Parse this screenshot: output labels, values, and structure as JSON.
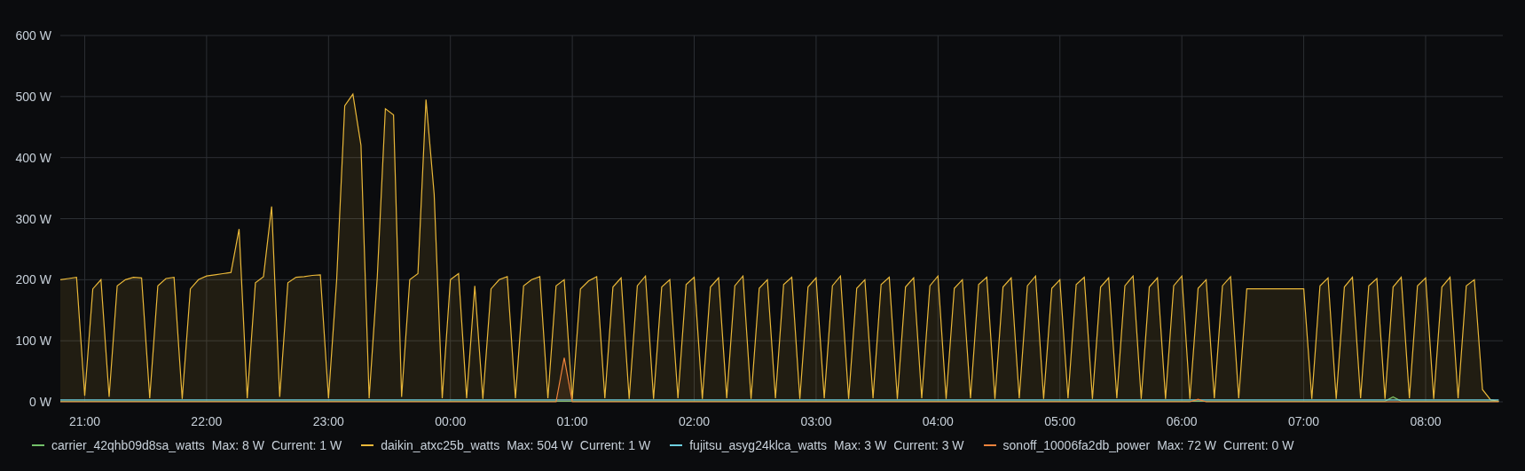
{
  "chart_data": {
    "type": "area",
    "grid": true,
    "ylim": [
      0,
      600
    ],
    "categories": [
      null,
      null,
      null,
      "21:00",
      null,
      null,
      null,
      null,
      null,
      null,
      null,
      null,
      null,
      null,
      null,
      null,
      null,
      null,
      "22:00",
      null,
      null,
      null,
      null,
      null,
      null,
      null,
      null,
      null,
      null,
      null,
      null,
      null,
      null,
      "23:00",
      null,
      null,
      null,
      null,
      null,
      null,
      null,
      null,
      null,
      null,
      null,
      null,
      null,
      null,
      "00:00",
      null,
      null,
      null,
      null,
      null,
      null,
      null,
      null,
      null,
      null,
      null,
      null,
      null,
      null,
      "01:00",
      null,
      null,
      null,
      null,
      null,
      null,
      null,
      null,
      null,
      null,
      null,
      null,
      null,
      null,
      "02:00",
      null,
      null,
      null,
      null,
      null,
      null,
      null,
      null,
      null,
      null,
      null,
      null,
      null,
      null,
      "03:00",
      null,
      null,
      null,
      null,
      null,
      null,
      null,
      null,
      null,
      null,
      null,
      null,
      null,
      null,
      "04:00",
      null,
      null,
      null,
      null,
      null,
      null,
      null,
      null,
      null,
      null,
      null,
      null,
      null,
      null,
      "05:00",
      null,
      null,
      null,
      null,
      null,
      null,
      null,
      null,
      null,
      null,
      null,
      null,
      null,
      null,
      "06:00",
      null,
      null,
      null,
      null,
      null,
      null,
      null,
      null,
      null,
      null,
      null,
      null,
      null,
      null,
      "07:00",
      null,
      null,
      null,
      null,
      null,
      null,
      null,
      null,
      null,
      null,
      null,
      null,
      null,
      null,
      "08:00",
      null,
      null,
      null,
      null,
      null,
      null,
      null,
      null,
      null
    ],
    "yticks": [
      {
        "value": 0,
        "label": "0 W"
      },
      {
        "value": 100,
        "label": "100 W"
      },
      {
        "value": 200,
        "label": "200 W"
      },
      {
        "value": 300,
        "label": "300 W"
      },
      {
        "value": 400,
        "label": "400 W"
      },
      {
        "value": 500,
        "label": "500 W"
      },
      {
        "value": 600,
        "label": "600 W"
      }
    ],
    "series": [
      {
        "name": "carrier_42qhb09d8sa_watts",
        "color": "#73bf69",
        "values": [
          1,
          1,
          1,
          1,
          1,
          1,
          1,
          1,
          1,
          1,
          1,
          1,
          1,
          1,
          1,
          1,
          1,
          1,
          1,
          1,
          1,
          1,
          1,
          1,
          1,
          1,
          1,
          1,
          1,
          1,
          1,
          1,
          1,
          1,
          1,
          1,
          1,
          1,
          1,
          1,
          1,
          1,
          1,
          1,
          1,
          1,
          1,
          1,
          1,
          1,
          1,
          1,
          1,
          1,
          1,
          1,
          1,
          1,
          1,
          1,
          1,
          1,
          1,
          1,
          1,
          1,
          1,
          1,
          1,
          1,
          1,
          1,
          1,
          1,
          1,
          1,
          1,
          1,
          1,
          1,
          1,
          1,
          1,
          1,
          1,
          1,
          1,
          1,
          1,
          1,
          1,
          1,
          1,
          1,
          1,
          1,
          1,
          1,
          1,
          1,
          1,
          1,
          1,
          1,
          1,
          1,
          1,
          1,
          1,
          1,
          1,
          1,
          1,
          1,
          1,
          1,
          1,
          1,
          1,
          1,
          1,
          1,
          1,
          1,
          1,
          1,
          1,
          1,
          1,
          1,
          1,
          1,
          1,
          1,
          1,
          1,
          1,
          1,
          1,
          1,
          1,
          1,
          1,
          1,
          1,
          1,
          1,
          1,
          1,
          1,
          1,
          1,
          1,
          1,
          1,
          1,
          1,
          1,
          1,
          1,
          1,
          1,
          1,
          1,
          8,
          1,
          1,
          1,
          1,
          1,
          1,
          1,
          1,
          1,
          1,
          1,
          1,
          1
        ]
      },
      {
        "name": "daikin_atxc25b_watts",
        "color": "#eab839",
        "values": [
          200,
          202,
          204,
          10,
          185,
          200,
          8,
          190,
          200,
          204,
          203,
          6,
          190,
          202,
          204,
          5,
          185,
          200,
          206,
          208,
          210,
          212,
          283,
          6,
          195,
          205,
          320,
          8,
          195,
          204,
          205,
          207,
          208,
          6,
          200,
          485,
          504,
          420,
          6,
          205,
          480,
          470,
          8,
          200,
          210,
          495,
          340,
          6,
          200,
          210,
          6,
          190,
          5,
          185,
          200,
          205,
          6,
          190,
          200,
          205,
          6,
          190,
          200,
          5,
          185,
          198,
          205,
          6,
          188,
          203,
          5,
          190,
          206,
          5,
          188,
          200,
          6,
          192,
          204,
          5,
          188,
          203,
          6,
          190,
          206,
          5,
          186,
          200,
          6,
          192,
          204,
          5,
          188,
          203,
          6,
          190,
          206,
          5,
          186,
          200,
          6,
          192,
          204,
          5,
          188,
          203,
          6,
          190,
          206,
          5,
          186,
          200,
          6,
          192,
          204,
          5,
          188,
          203,
          6,
          190,
          206,
          5,
          186,
          200,
          6,
          192,
          204,
          5,
          188,
          203,
          6,
          190,
          206,
          5,
          188,
          203,
          5,
          190,
          206,
          5,
          186,
          200,
          6,
          190,
          205,
          6,
          185,
          185,
          185,
          185,
          185,
          185,
          185,
          185,
          5,
          190,
          203,
          5,
          188,
          204,
          6,
          190,
          202,
          5,
          188,
          204,
          6,
          190,
          203,
          5,
          188,
          204,
          6,
          190,
          200,
          20,
          3,
          1
        ]
      },
      {
        "name": "fujitsu_asyg24klca_watts",
        "color": "#6ed0e0",
        "values": [
          3,
          3,
          3,
          3,
          3,
          3,
          3,
          3,
          3,
          3,
          3,
          3,
          3,
          3,
          3,
          3,
          3,
          3,
          3,
          3,
          3,
          3,
          3,
          3,
          3,
          3,
          3,
          3,
          3,
          3,
          3,
          3,
          3,
          3,
          3,
          3,
          3,
          3,
          3,
          3,
          3,
          3,
          3,
          3,
          3,
          3,
          3,
          3,
          3,
          3,
          3,
          3,
          3,
          3,
          3,
          3,
          3,
          3,
          3,
          3,
          3,
          3,
          3,
          3,
          3,
          3,
          3,
          3,
          3,
          3,
          3,
          3,
          3,
          3,
          3,
          3,
          3,
          3,
          3,
          3,
          3,
          3,
          3,
          3,
          3,
          3,
          3,
          3,
          3,
          3,
          3,
          3,
          3,
          3,
          3,
          3,
          3,
          3,
          3,
          3,
          3,
          3,
          3,
          3,
          3,
          3,
          3,
          3,
          3,
          3,
          3,
          3,
          3,
          3,
          3,
          3,
          3,
          3,
          3,
          3,
          3,
          3,
          3,
          3,
          3,
          3,
          3,
          3,
          3,
          3,
          3,
          3,
          3,
          3,
          3,
          3,
          3,
          3,
          3,
          3,
          3,
          3,
          3,
          3,
          3,
          3,
          3,
          3,
          3,
          3,
          3,
          3,
          3,
          3,
          3,
          3,
          3,
          3,
          3,
          3,
          3,
          3,
          3,
          3,
          3,
          3,
          3,
          3,
          3,
          3,
          3,
          3,
          3,
          3,
          3,
          3,
          3,
          3
        ]
      },
      {
        "name": "sonoff_10006fa2db_power",
        "color": "#ef843c",
        "values": [
          0,
          0,
          0,
          0,
          0,
          0,
          0,
          0,
          0,
          0,
          0,
          0,
          0,
          0,
          0,
          0,
          0,
          0,
          0,
          0,
          0,
          0,
          0,
          0,
          0,
          0,
          0,
          0,
          0,
          0,
          0,
          0,
          0,
          0,
          0,
          0,
          0,
          0,
          0,
          0,
          0,
          0,
          0,
          0,
          0,
          0,
          0,
          0,
          0,
          0,
          0,
          0,
          0,
          0,
          0,
          0,
          0,
          0,
          0,
          0,
          0,
          0,
          72,
          0,
          0,
          0,
          0,
          0,
          0,
          0,
          0,
          0,
          0,
          0,
          0,
          0,
          0,
          0,
          0,
          0,
          0,
          0,
          0,
          0,
          0,
          0,
          0,
          0,
          0,
          0,
          0,
          0,
          0,
          0,
          0,
          0,
          0,
          0,
          0,
          0,
          0,
          0,
          0,
          0,
          0,
          0,
          0,
          0,
          0,
          0,
          0,
          0,
          0,
          0,
          0,
          0,
          0,
          0,
          0,
          0,
          0,
          0,
          0,
          0,
          0,
          0,
          0,
          0,
          0,
          0,
          0,
          0,
          0,
          0,
          0,
          0,
          0,
          0,
          0,
          0,
          4,
          0,
          0,
          0,
          0,
          0,
          0,
          0,
          0,
          0,
          0,
          0,
          0,
          0,
          0,
          0,
          0,
          0,
          0,
          0,
          0,
          0,
          0,
          0,
          0,
          0,
          0,
          0,
          0,
          0,
          0,
          0,
          0,
          0,
          0,
          0,
          0,
          0
        ]
      }
    ]
  },
  "legend": [
    {
      "max": "Max: 8 W",
      "current": "Current: 1 W"
    },
    {
      "max": "Max: 504 W",
      "current": "Current: 1 W"
    },
    {
      "max": "Max: 3 W",
      "current": "Current: 3 W"
    },
    {
      "max": "Max: 72 W",
      "current": "Current: 0 W"
    }
  ]
}
